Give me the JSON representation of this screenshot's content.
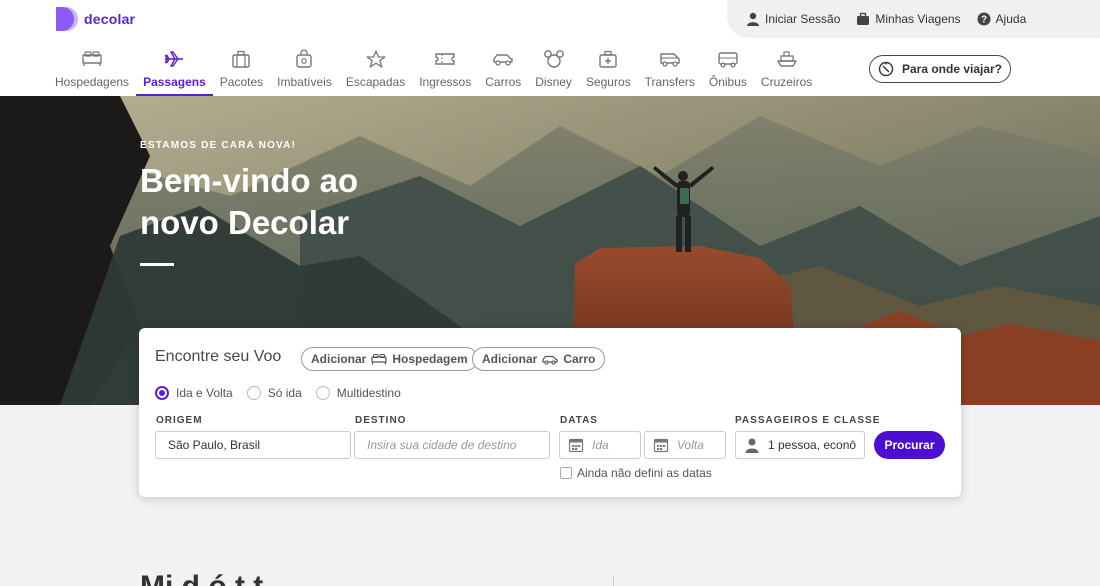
{
  "brand": {
    "name": "decolar",
    "color": "#5a1fd6"
  },
  "topbar": {
    "login": {
      "label": "Iniciar Sessão",
      "icon": "user-icon"
    },
    "trips": {
      "label": "Minhas Viagens",
      "icon": "suitcase-icon"
    },
    "help": {
      "label": "Ajuda",
      "icon": "question-icon"
    }
  },
  "nav": {
    "items": [
      {
        "label": "Hospedagens",
        "icon": "bed-icon"
      },
      {
        "label": "Passagens",
        "icon": "plane-icon",
        "active": true
      },
      {
        "label": "Pacotes",
        "icon": "suitcase-icon"
      },
      {
        "label": "Imbatíveis",
        "icon": "tag-bag-icon"
      },
      {
        "label": "Escapadas",
        "icon": "star-icon"
      },
      {
        "label": "Ingressos",
        "icon": "ticket-icon"
      },
      {
        "label": "Carros",
        "icon": "car-icon"
      },
      {
        "label": "Disney",
        "icon": "mickey-icon"
      },
      {
        "label": "Seguros",
        "icon": "medkit-icon"
      },
      {
        "label": "Transfers",
        "icon": "van-icon"
      },
      {
        "label": "Ônibus",
        "icon": "bus-icon"
      },
      {
        "label": "Cruzeiros",
        "icon": "ship-icon"
      }
    ],
    "destination_button": "Para onde viajar?"
  },
  "hero": {
    "eyebrow": "ESTAMOS DE CARA NOVA!",
    "title": "Bem-vindo ao novo Decolar"
  },
  "search": {
    "title": "Encontre seu Voo",
    "add_lodging": {
      "prefix": "Adicionar",
      "label": "Hospedagem"
    },
    "add_car": {
      "prefix": "Adicionar",
      "label": "Carro"
    },
    "trip_types": [
      {
        "label": "Ida e Volta",
        "checked": true
      },
      {
        "label": "Só ida",
        "checked": false
      },
      {
        "label": "Multidestino",
        "checked": false
      }
    ],
    "origin": {
      "label": "ORIGEM",
      "value": "São Paulo, Brasil"
    },
    "destination": {
      "label": "DESTINO",
      "placeholder": "Insira sua cidade de destino"
    },
    "dates": {
      "label": "DATAS",
      "departure_placeholder": "Ida",
      "return_placeholder": "Volta"
    },
    "passengers": {
      "label": "PASSAGEIROS E CLASSE",
      "value": "1 pessoa, econô"
    },
    "submit": "Procurar",
    "no_dates_label": "Ainda não defini as datas"
  },
  "below": {
    "title": "Mi  d        ó    t  t"
  }
}
